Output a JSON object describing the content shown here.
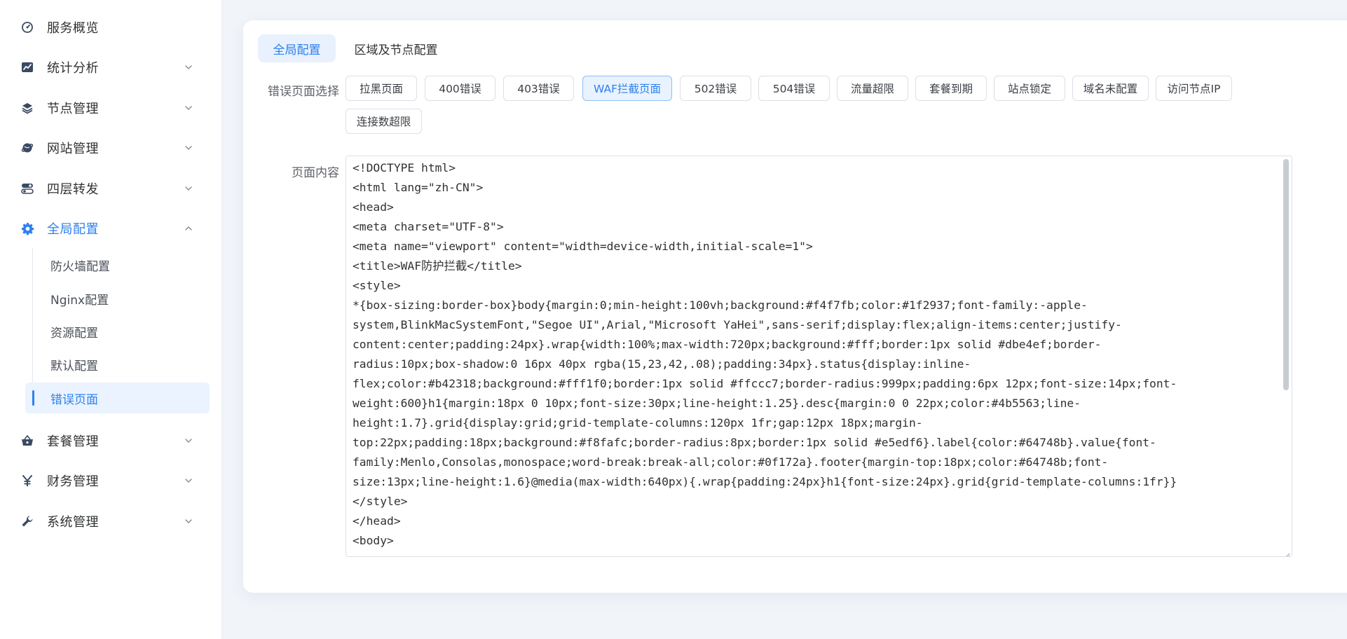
{
  "sidebar": {
    "items": [
      {
        "label": "服务概览",
        "icon": "gauge-icon",
        "has_chevron": false
      },
      {
        "label": "统计分析",
        "icon": "chart-icon",
        "has_chevron": true
      },
      {
        "label": "节点管理",
        "icon": "layers-icon",
        "has_chevron": true
      },
      {
        "label": "网站管理",
        "icon": "globe-icon",
        "has_chevron": true
      },
      {
        "label": "四层转发",
        "icon": "toggle-icon",
        "has_chevron": true
      },
      {
        "label": "全局配置",
        "icon": "gear-icon",
        "has_chevron": true,
        "expanded": true,
        "active": true
      },
      {
        "label": "套餐管理",
        "icon": "basket-icon",
        "has_chevron": true
      },
      {
        "label": "财务管理",
        "icon": "yen-icon",
        "has_chevron": true
      },
      {
        "label": "系统管理",
        "icon": "wrench-icon",
        "has_chevron": true
      }
    ],
    "sub_items": [
      {
        "label": "防火墙配置"
      },
      {
        "label": "Nginx配置"
      },
      {
        "label": "资源配置"
      },
      {
        "label": "默认配置"
      },
      {
        "label": "错误页面",
        "active": true
      }
    ]
  },
  "main": {
    "tabs": [
      {
        "label": "全局配置",
        "active": true
      },
      {
        "label": "区域及节点配置",
        "active": false
      }
    ],
    "error_page_label": "错误页面选择",
    "error_pages": [
      {
        "label": "拉黑页面"
      },
      {
        "label": "400错误"
      },
      {
        "label": "403错误"
      },
      {
        "label": "WAF拦截页面",
        "active": true
      },
      {
        "label": "502错误"
      },
      {
        "label": "504错误"
      },
      {
        "label": "流量超限"
      },
      {
        "label": "套餐到期"
      },
      {
        "label": "站点锁定"
      },
      {
        "label": "域名未配置"
      },
      {
        "label": "访问节点IP"
      },
      {
        "label": "连接数超限"
      }
    ],
    "content_label": "页面内容",
    "content_lines": [
      "<!DOCTYPE html>",
      "<html lang=\"zh-CN\">",
      "<head>",
      "<meta charset=\"UTF-8\">",
      "<meta name=\"viewport\" content=\"width=device-width,initial-scale=1\">",
      "<title>WAF防护拦截</title>",
      "<style>",
      "*{box-sizing:border-box}body{margin:0;min-height:100vh;background:#f4f7fb;color:#1f2937;font-family:-apple-",
      "system,BlinkMacSystemFont,\"Segoe UI\",Arial,\"Microsoft YaHei\",sans-serif;display:flex;align-items:center;justify-",
      "content:center;padding:24px}.wrap{width:100%;max-width:720px;background:#fff;border:1px solid #dbe4ef;border-",
      "radius:10px;box-shadow:0 16px 40px rgba(15,23,42,.08);padding:34px}.status{display:inline-",
      "flex;color:#b42318;background:#fff1f0;border:1px solid #ffccc7;border-radius:999px;padding:6px 12px;font-size:14px;font-",
      "weight:600}h1{margin:18px 0 10px;font-size:30px;line-height:1.25}.desc{margin:0 0 22px;color:#4b5563;line-",
      "height:1.7}.grid{display:grid;grid-template-columns:120px 1fr;gap:12px 18px;margin-",
      "top:22px;padding:18px;background:#f8fafc;border-radius:8px;border:1px solid #e5edf6}.label{color:#64748b}.value{font-",
      "family:Menlo,Consolas,monospace;word-break:break-all;color:#0f172a}.footer{margin-top:18px;color:#64748b;font-",
      "size:13px;line-height:1.6}@media(max-width:640px){.wrap{padding:24px}h1{font-size:24px}.grid{grid-template-columns:1fr}}",
      "</style>",
      "</head>",
      "<body>"
    ]
  },
  "colors": {
    "accent": "#2f80ed",
    "page_bg": "#f1f4f9",
    "active_bg": "#e8f1fd"
  }
}
